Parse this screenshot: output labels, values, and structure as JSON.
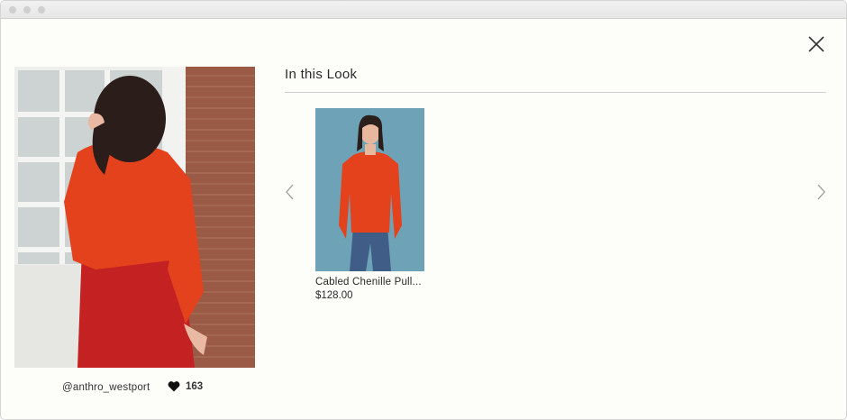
{
  "modal": {
    "section_title": "In this Look"
  },
  "photo": {
    "handle": "@anthro_westport",
    "likes": "163"
  },
  "products": [
    {
      "name": "Cabled Chenille Pull...",
      "price": "$128.00"
    }
  ],
  "colors": {
    "sweater": "#e4421d",
    "skirt": "#c42222",
    "brick": "#9a5a45",
    "product_bg": "#6ea3b7",
    "denim": "#3f5d86",
    "background": "#fdfdf9"
  },
  "icons": {
    "close": "close-icon",
    "heart": "heart-icon",
    "prev": "chevron-left-icon",
    "next": "chevron-right-icon"
  }
}
